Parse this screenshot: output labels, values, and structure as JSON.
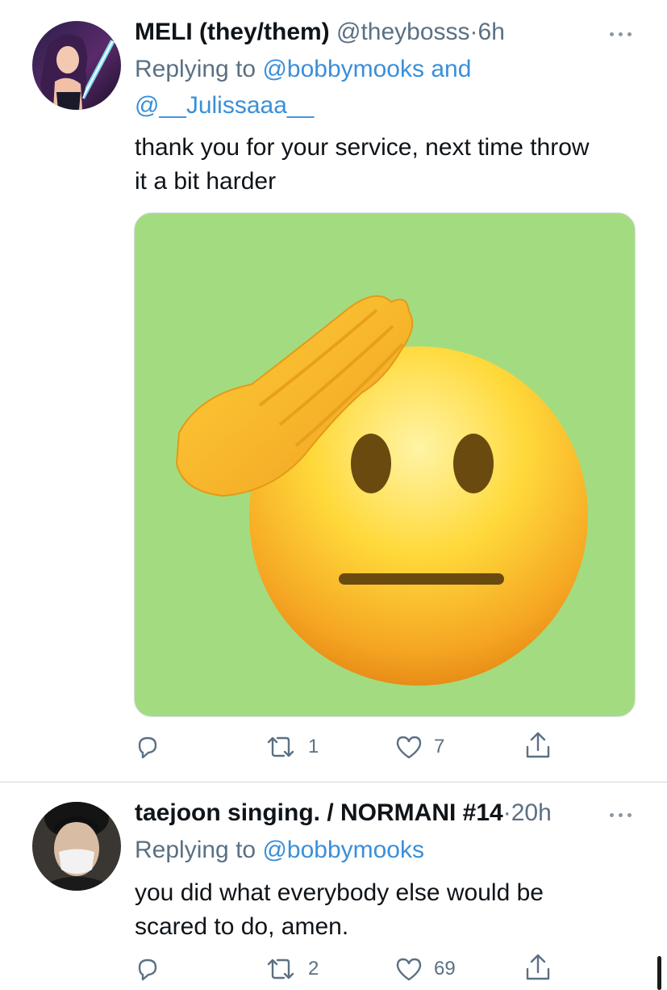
{
  "tweets": [
    {
      "author_name": "MELI (they/them)",
      "handle": "@theybosss",
      "dot": "·",
      "time": "6h",
      "replying_prefix": "Replying to",
      "replying_to_1": "@bobbymooks",
      "replying_and": "and",
      "replying_to_2": "@__Julissaaa__",
      "text_line1": "thank you for your service, next time throw",
      "text_line2": "it a bit harder",
      "media_alt_icon": "saluting-face-emoji",
      "actions": {
        "replies": "",
        "retweets": "1",
        "likes": "7"
      }
    },
    {
      "author_name": "taejoon singing. / NORMANI #14",
      "handle": "",
      "dot": "·",
      "time": "20h",
      "replying_prefix": "Replying to",
      "replying_to_1": "@bobbymooks",
      "text_line1": "you did what everybody else would be",
      "text_line2": "scared to do, amen.",
      "actions": {
        "replies": "",
        "retweets": "2",
        "likes": "69"
      }
    }
  ],
  "icons": {
    "reply": "reply-icon",
    "retweet": "retweet-icon",
    "like": "heart-icon",
    "share": "share-icon",
    "more": "more-icon"
  },
  "colors": {
    "link": "#3a8fd9",
    "muted": "#5b7083",
    "media_bg": "#a3dc80"
  }
}
